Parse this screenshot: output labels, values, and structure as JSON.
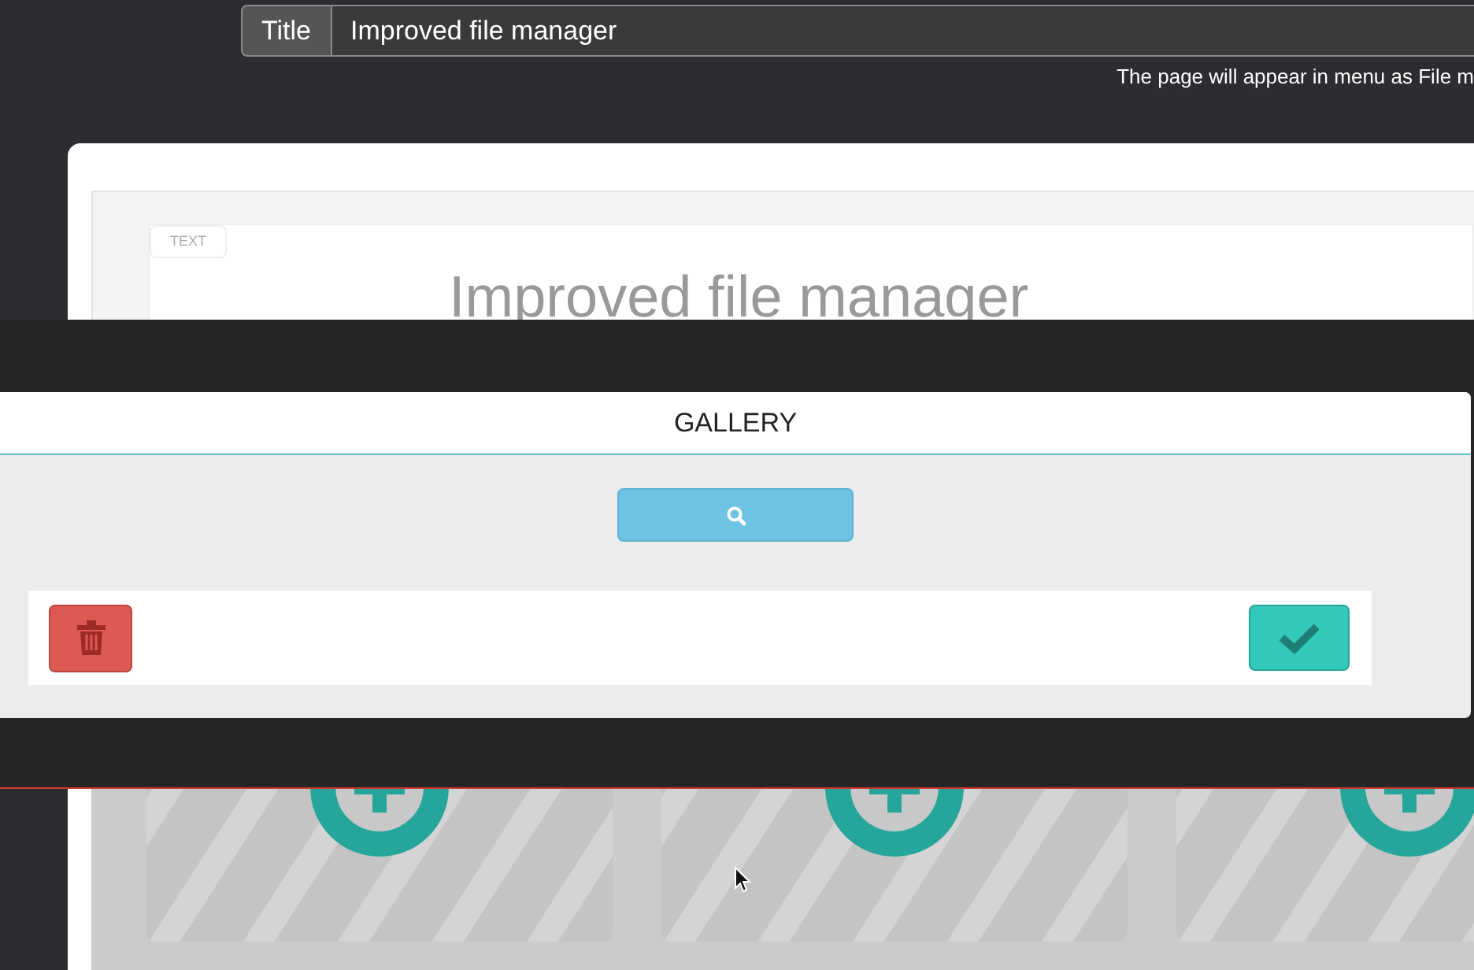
{
  "title_field": {
    "label": "Title",
    "value": "Improved file manager"
  },
  "hint": "The page will appear in menu as File m",
  "text_block": {
    "tag": "TEXT",
    "heading": "Improved file manager"
  },
  "tiles": [
    {
      "kind": "add"
    },
    {
      "kind": "add"
    },
    {
      "kind": "add"
    }
  ],
  "modal": {
    "title": "GALLERY"
  }
}
